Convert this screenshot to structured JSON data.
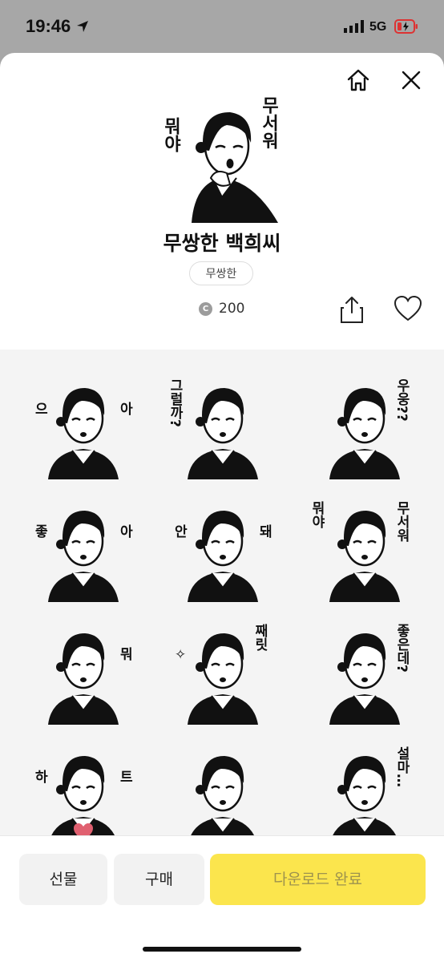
{
  "status_bar": {
    "time": "19:46",
    "network": "5G"
  },
  "sticker": {
    "title": "무쌍한 백희씨",
    "tag": "무쌍한",
    "coin_symbol": "C",
    "price": "200",
    "hero_text": {
      "left": "뭐야",
      "right": "무서워"
    }
  },
  "grid": {
    "items": [
      {
        "left": "으",
        "right": "아",
        "pose": "cover"
      },
      {
        "left": "그럴까?",
        "right": "",
        "pose": "phone"
      },
      {
        "left": "",
        "right": "우웅??",
        "pose": "think"
      },
      {
        "left": "좋",
        "right": "아",
        "pose": "thumb"
      },
      {
        "left": "안",
        "right": "돼",
        "pose": "cross"
      },
      {
        "left": "뭐야",
        "right": "무서워",
        "pose": "scared"
      },
      {
        "left": "",
        "right": "뭐",
        "pose": "plain"
      },
      {
        "left": "✧",
        "right": "째릿",
        "pose": "glare"
      },
      {
        "left": "",
        "right": "좋은데?",
        "pose": "chin"
      },
      {
        "left": "하",
        "right": "트",
        "pose": "heart"
      },
      {
        "left": "",
        "right": "",
        "pose": "hearthands"
      },
      {
        "left": "",
        "right": "설마…",
        "pose": "gasp"
      }
    ]
  },
  "actions": {
    "gift": "선물",
    "buy": "구매",
    "download": "다운로드 완료"
  }
}
